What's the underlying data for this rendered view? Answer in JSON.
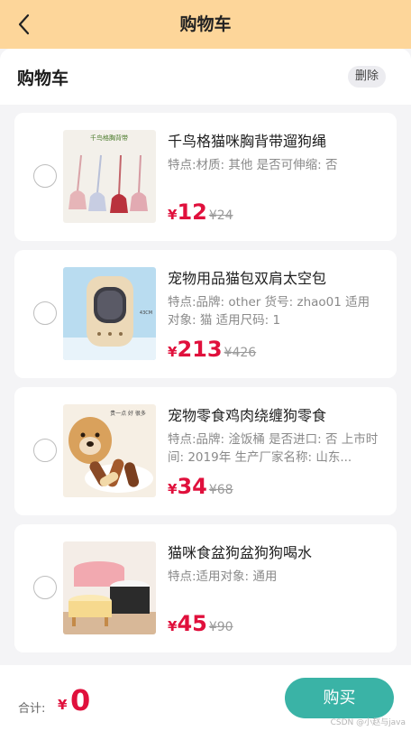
{
  "nav": {
    "title": "购物车",
    "back_icon": "chevron-left-icon"
  },
  "subhead": {
    "title": "购物车",
    "delete_label": "删除"
  },
  "items": [
    {
      "name": "千鸟格猫咪胸背带遛狗绳",
      "desc": "特点:材质: 其他 是否可伸缩: 否",
      "currency": "¥",
      "price": "12",
      "old_price": "¥24",
      "image_text": "千鸟格胸背带"
    },
    {
      "name": "宠物用品猫包双肩太空包",
      "desc": "特点:品牌: other 货号: zhao01 适用对象: 猫 适用尺码: 1",
      "currency": "¥",
      "price": "213",
      "old_price": "¥426",
      "image_text": "43CM"
    },
    {
      "name": "宠物零食鸡肉绕缠狗零食",
      "desc": "特点:品牌: 淦饭桶 是否进口: 否 上市时间: 2019年 生产厂家名称: 山东...",
      "currency": "¥",
      "price": "34",
      "old_price": "¥68",
      "image_text": "贵一点 好 很多"
    },
    {
      "name": "猫咪食盆狗盆狗狗喝水",
      "desc": "特点:适用对象: 通用",
      "currency": "¥",
      "price": "45",
      "old_price": "¥90",
      "image_text": ""
    }
  ],
  "footer": {
    "total_label": "合计:",
    "total_currency": "¥",
    "total_value": "0",
    "buy_label": "购买"
  },
  "watermark": "CSDN @小赵与java",
  "colors": {
    "nav_bg": "#fdd69a",
    "price": "#e0103c",
    "buy_button": "#3ab3a6",
    "page_bg": "#f4f4f6"
  }
}
